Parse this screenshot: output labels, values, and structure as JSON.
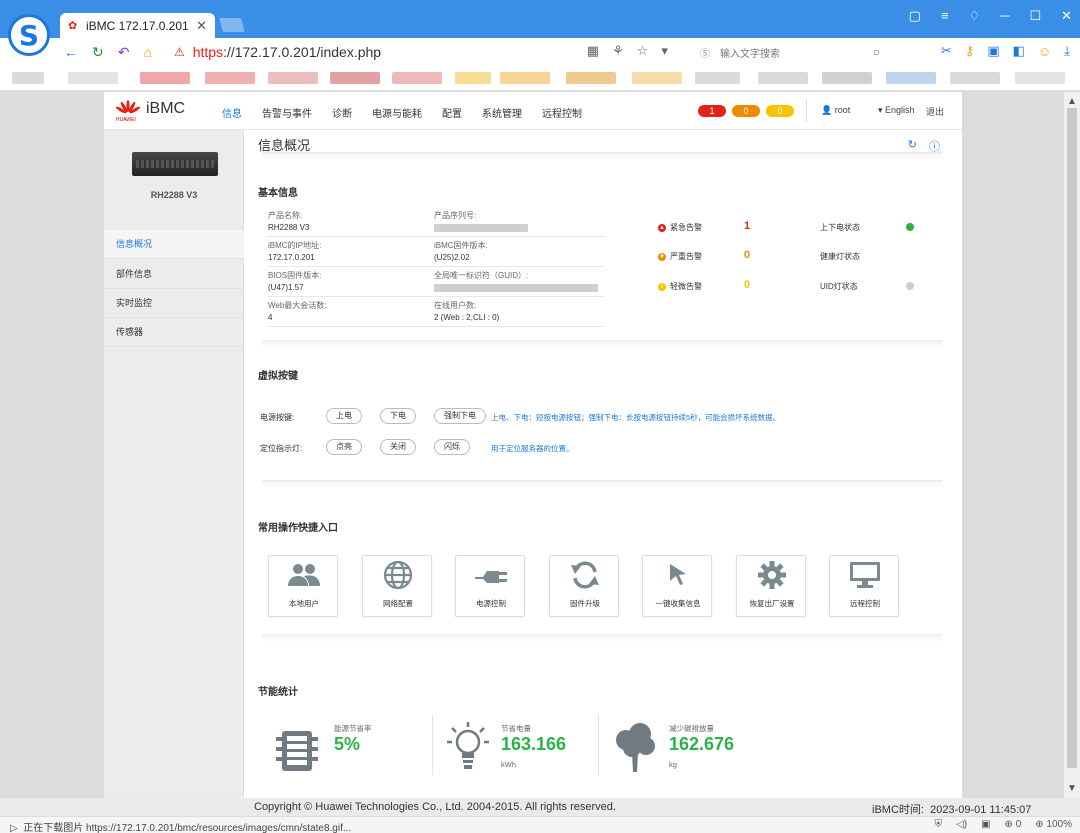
{
  "browser": {
    "tab_title": "iBMC 172.17.0.201",
    "url_scheme": "https",
    "url_rest": "://172.17.0.201/index.php",
    "search_placeholder": "输入文字搜索",
    "status_text": "正在下载图片 https://172.17.0.201/bmc/resources/images/cmn/state8.gif...",
    "zoom": "100%",
    "shield_count": "0"
  },
  "header": {
    "brand_sub": "HUAWEI",
    "brand": "iBMC",
    "nav": [
      "信息",
      "告警与事件",
      "诊断",
      "电源与能耗",
      "配置",
      "系统管理",
      "远程控制"
    ],
    "alarm_critical": "1",
    "alarm_major": "0",
    "alarm_minor": "0",
    "user": "root",
    "language": "English",
    "logout": "退出"
  },
  "sidebar": {
    "server_model": "RH2288 V3",
    "items": [
      "信息概况",
      "部件信息",
      "实时监控",
      "传感器"
    ]
  },
  "main": {
    "title": "信息概况",
    "basic_info": {
      "title": "基本信息",
      "product_name_label": "产品名称:",
      "product_name": "RH2288 V3",
      "serial_label": "产品序列号:",
      "ip_label": "iBMC的IP地址:",
      "ip": "172.17.0.201",
      "fw_label": "iBMC固件版本:",
      "fw": "(U25)2.02",
      "bios_label": "BIOS固件版本:",
      "bios": "(U47)1.57",
      "guid_label": "全局唯一标识符（GUID）:",
      "web_label": "Web最大会话数:",
      "web": "4",
      "online_label": "在线用户数:",
      "online": "2 (Web : 2,CLI : 0)"
    },
    "alarms": {
      "critical_label": "紧急告警",
      "critical": "1",
      "major_label": "严重告警",
      "major": "0",
      "minor_label": "轻微告警",
      "minor": "0",
      "power_state_label": "上下电状态",
      "health_led_label": "健康灯状态",
      "uid_led_label": "UID灯状态"
    },
    "virtual_buttons": {
      "title": "虚拟按键",
      "power_label": "电源按键:",
      "power_on": "上电",
      "power_off": "下电",
      "force_off": "强制下电",
      "power_hint": "上电、下电：短按电源按钮；强制下电：长按电源按钮持续5秒，可能会损坏系统数据。",
      "locator_label": "定位指示灯:",
      "led_on": "点亮",
      "led_off": "关闭",
      "led_blink": "闪烁",
      "locator_hint": "用于定位服务器的位置。"
    },
    "quick_access": {
      "title": "常用操作快捷入口",
      "items": [
        "本地用户",
        "网络配置",
        "电源控制",
        "固件升级",
        "一键收集信息",
        "恢复出厂设置",
        "远程控制"
      ]
    },
    "energy": {
      "title": "节能统计",
      "rate_label": "能源节省率",
      "rate": "5%",
      "power_label": "节省电量",
      "power": "163.166",
      "power_unit": "kWh",
      "co2_label": "减少碳排放量",
      "co2": "162.676",
      "co2_unit": "kg"
    }
  },
  "footer": {
    "copyright": "Copyright © Huawei Technologies Co., Ltd. 2004-2015. All rights reserved.",
    "time_label": "iBMC时间:",
    "time": "2023-09-01 11:45:07"
  },
  "colors": {
    "accent": "#1b78de",
    "critical": "#e2231a",
    "major": "#f08a00",
    "minor": "#f5c400",
    "green": "#2bb34a"
  }
}
